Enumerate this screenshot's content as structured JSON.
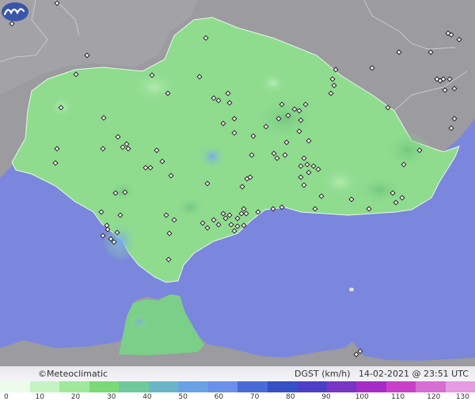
{
  "footer": {
    "copyright": "©Meteoclimatic",
    "variable": "DGST (km/h)",
    "date": "14-02-2021",
    "at": "@",
    "time": "23:51 UTC"
  },
  "scale": {
    "labels": [
      "0",
      "10",
      "20",
      "30",
      "40",
      "50",
      "60",
      "70",
      "80",
      "90",
      "100",
      "110",
      "120",
      "130"
    ],
    "colors": [
      "#ecfbec",
      "#c6f3c4",
      "#9ee99b",
      "#7ada78",
      "#70c99a",
      "#6ab6c8",
      "#6aa2e4",
      "#6c8fe9",
      "#4a6ad8",
      "#3450c4",
      "#4d3ec8",
      "#7736c4",
      "#a52cc8",
      "#c940c8",
      "#d86dd4",
      "#e69be2"
    ]
  },
  "icons": {
    "logo": "meteoclimatic-logo",
    "station": "station-marker-icon"
  },
  "colors": {
    "sea": "#7b86dd",
    "land_other": "#9a9a9e",
    "region": "#8fdc8f"
  }
}
